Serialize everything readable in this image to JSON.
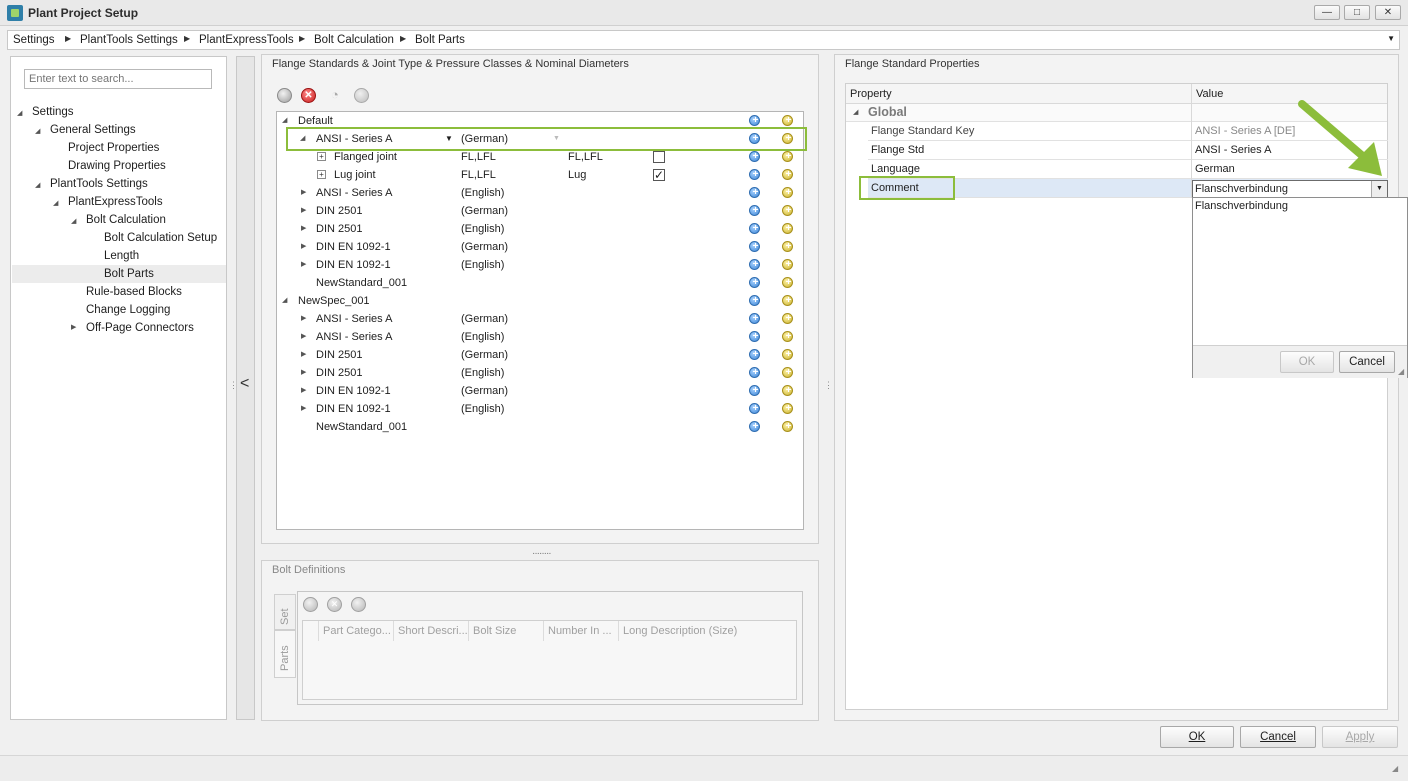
{
  "window": {
    "title": "Plant Project Setup",
    "minimize": "—",
    "maximize": "□",
    "close": "✕"
  },
  "breadcrumb": [
    "Settings",
    "PlantTools Settings",
    "PlantExpressTools",
    "Bolt Calculation",
    "Bolt Parts"
  ],
  "search": {
    "placeholder": "Enter text to search..."
  },
  "nav": {
    "items": [
      {
        "label": "Settings"
      },
      {
        "label": "General Settings"
      },
      {
        "label": "Project Properties"
      },
      {
        "label": "Drawing Properties"
      },
      {
        "label": "PlantTools Settings"
      },
      {
        "label": "PlantExpressTools"
      },
      {
        "label": "Bolt Calculation"
      },
      {
        "label": "Bolt Calculation Setup"
      },
      {
        "label": "Length"
      },
      {
        "label": "Bolt Parts"
      },
      {
        "label": "Rule-based Blocks"
      },
      {
        "label": "Change Logging"
      },
      {
        "label": "Off-Page Connectors"
      }
    ]
  },
  "flange_panel": {
    "title": "Flange Standards & Joint Type & Pressure Classes & Nominal Diameters",
    "rows": [
      {
        "name": "Default",
        "lang": "",
        "c3": "",
        "c4": ""
      },
      {
        "name": "ANSI - Series A",
        "lang": "(German)",
        "c3": "",
        "c4": ""
      },
      {
        "name": "Flanged joint",
        "lang": "FL,LFL",
        "c3": "FL,LFL",
        "c4": ""
      },
      {
        "name": "Lug joint",
        "lang": "FL,LFL",
        "c3": "Lug",
        "c4": ""
      },
      {
        "name": "ANSI - Series A",
        "lang": "(English)",
        "c3": "",
        "c4": ""
      },
      {
        "name": "DIN 2501",
        "lang": "(German)",
        "c3": "",
        "c4": ""
      },
      {
        "name": "DIN 2501",
        "lang": "(English)",
        "c3": "",
        "c4": ""
      },
      {
        "name": "DIN EN 1092-1",
        "lang": "(German)",
        "c3": "",
        "c4": ""
      },
      {
        "name": "DIN EN 1092-1",
        "lang": "(English)",
        "c3": "",
        "c4": ""
      },
      {
        "name": "NewStandard_001",
        "lang": "",
        "c3": "",
        "c4": ""
      },
      {
        "name": "NewSpec_001",
        "lang": "",
        "c3": "",
        "c4": ""
      },
      {
        "name": "ANSI - Series A",
        "lang": "(German)",
        "c3": "",
        "c4": ""
      },
      {
        "name": "ANSI - Series A",
        "lang": "(English)",
        "c3": "",
        "c4": ""
      },
      {
        "name": "DIN 2501",
        "lang": "(German)",
        "c3": "",
        "c4": ""
      },
      {
        "name": "DIN 2501",
        "lang": "(English)",
        "c3": "",
        "c4": ""
      },
      {
        "name": "DIN EN 1092-1",
        "lang": "(German)",
        "c3": "",
        "c4": ""
      },
      {
        "name": "DIN EN 1092-1",
        "lang": "(English)",
        "c3": "",
        "c4": ""
      },
      {
        "name": "NewStandard_001",
        "lang": "",
        "c3": "",
        "c4": ""
      }
    ],
    "flanged_checked": false,
    "lug_checked": true
  },
  "bolt_panel": {
    "title": "Bolt Definitions",
    "tabs": [
      "Set",
      "Parts"
    ],
    "columns": [
      "Part Catego...",
      "Short Descri...",
      "Bolt Size",
      "Number In ...",
      "Long Description (Size)"
    ]
  },
  "props_panel": {
    "title": "Flange Standard Properties",
    "col_property": "Property",
    "col_value": "Value",
    "category": "Global",
    "rows": [
      {
        "name": "Flange Standard Key",
        "value": "ANSI - Series A [DE]"
      },
      {
        "name": "Flange Std",
        "value": "ANSI - Series A"
      },
      {
        "name": "Language",
        "value": "German"
      },
      {
        "name": "Comment",
        "value": "Flanschverbindung"
      }
    ],
    "popup_text": "Flanschverbindung",
    "popup_ok": "OK",
    "popup_cancel": "Cancel"
  },
  "footer": {
    "ok": "OK",
    "cancel": "Cancel",
    "apply": "Apply"
  },
  "colors": {
    "highlight": "#8cbd3b",
    "arrow": "#8cbd3b"
  }
}
